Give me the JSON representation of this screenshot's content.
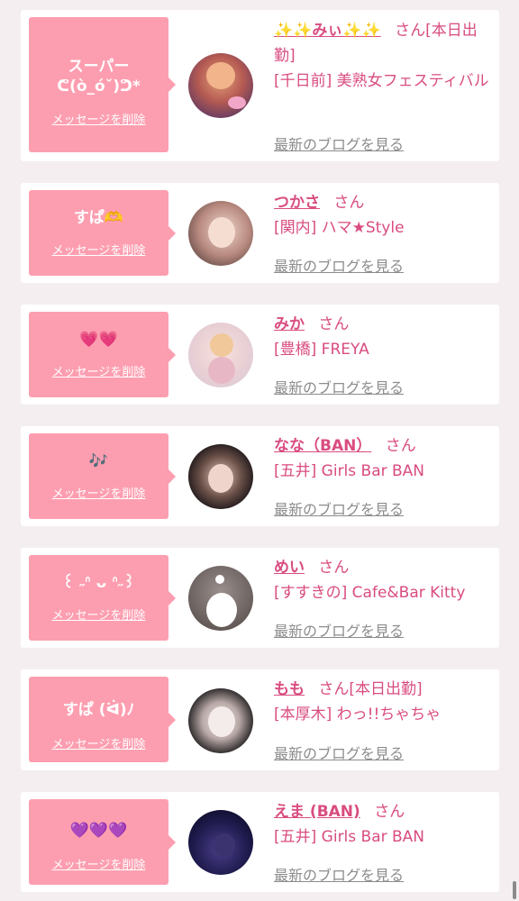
{
  "delete_label": "メッセージを削除",
  "blog_label": "最新のブログを見る",
  "san_label": "さん",
  "colors": {
    "page_bg": "#f4eef1",
    "bubble": "#fd9eb0",
    "name": "#d94c80",
    "blog_link": "#8c8c8c"
  },
  "entries": [
    {
      "message": "スーパー\nᕦ(ò_óˇ)ᕤ*",
      "name": "✨✨みぃ✨✨",
      "name_suffix": "さん[本日出勤]",
      "shop": "[千日前] 美熟女フェスティバル",
      "avatar_icon": "avatar-photo-icon"
    },
    {
      "message": "すぱ🫶",
      "name": "つかさ",
      "name_suffix": "さん",
      "shop": "[関内] ハマ★Style",
      "avatar_icon": "avatar-photo-icon"
    },
    {
      "message": "💗💗",
      "name": "みか",
      "name_suffix": "さん",
      "shop": "[豊橋] FREYA",
      "avatar_icon": "avatar-photo-icon"
    },
    {
      "message": "🎶",
      "name": "なな（BAN）",
      "name_suffix": "さん",
      "shop": "[五井] Girls Bar BAN",
      "avatar_icon": "avatar-photo-icon"
    },
    {
      "message": "꒰ ˶ᐢ ᴗ ᐢ˶꒱",
      "name": "めい",
      "name_suffix": "さん",
      "shop": "[すすきの] Cafe&Bar Kitty",
      "avatar_icon": "avatar-photo-icon"
    },
    {
      "message": "すぱ (ᐛ)ﾉ",
      "name": "もも",
      "name_suffix": "さん[本日出勤]",
      "shop": "[本厚木] わっ!!ちゃちゃ",
      "avatar_icon": "avatar-photo-icon"
    },
    {
      "message": "💜💜💜",
      "name": "えま (BAN)",
      "name_suffix": "さん",
      "shop": "[五井] Girls Bar BAN",
      "avatar_icon": "avatar-photo-icon"
    }
  ]
}
